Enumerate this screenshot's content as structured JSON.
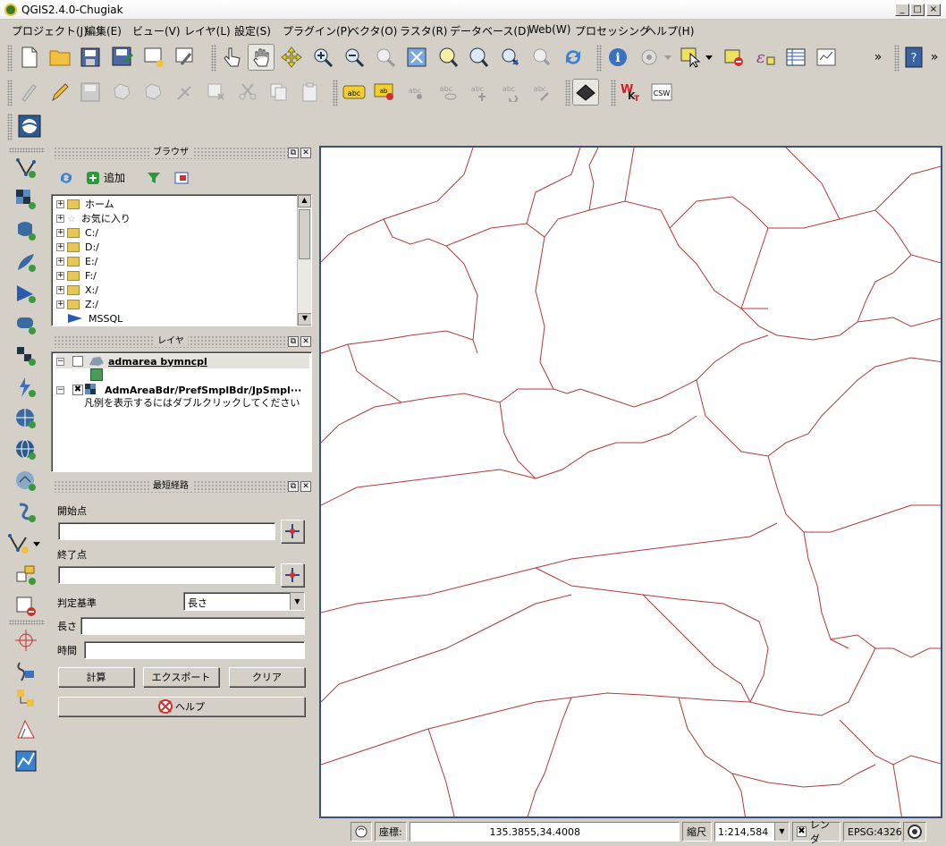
{
  "window": {
    "title": "QGIS2.4.0-Chugiak",
    "minimize": "_",
    "maximize": "□",
    "close": "×"
  },
  "menu": [
    "プロジェクト(J)",
    "編集(E)",
    "ビュー(V)",
    "レイヤ(L)",
    "設定(S)",
    "プラグイン(P)",
    "ベクタ(O)",
    "ラスタ(R)",
    "データベース(D)",
    "Web(W)",
    "プロセッシング",
    "ヘルプ(H)"
  ],
  "toolbar_overflow": "»",
  "toolbar_wkt": {
    "w": "W",
    "k": "K",
    "t": "T"
  },
  "toolbar_csw": "CSW",
  "browser": {
    "title": "ブラウザ",
    "add_label": "追加",
    "items": [
      "ホーム",
      "お気に入り",
      "C:/",
      "D:/",
      "E:/",
      "F:/",
      "X:/",
      "Z:/",
      "MSSQL"
    ]
  },
  "layers": {
    "title": "レイヤ",
    "items": [
      {
        "name": "admarea bymncpl",
        "checked": false
      },
      {
        "name": "AdmAreaBdr/PrefSmplBdr/JpSmpl···",
        "checked": true,
        "legend_hint": "凡例を表示するにはダブルクリックしてください"
      }
    ],
    "fill_color": "#4a9a5a"
  },
  "shortest_path": {
    "title": "最短経路",
    "start_label": "開始点",
    "start_value": "",
    "end_label": "終了点",
    "end_value": "",
    "criteria_label": "判定基準",
    "criteria_value": "長さ",
    "length_label": "長さ",
    "length_value": "",
    "time_label": "時間",
    "time_value": "",
    "calc_button": "計算",
    "export_button": "エクスポート",
    "clear_button": "クリア",
    "help_button": "ヘルプ"
  },
  "status": {
    "coord_label": "座標:",
    "coord_value": "135.3855,34.4008",
    "scale_label": "縮尺",
    "scale_value": "1:214,584",
    "render_label": "レンダ",
    "render_checked": true,
    "crs": "EPSG:4326"
  },
  "map": {
    "boundary_color": "#b03a3a",
    "background": "#ffffff"
  }
}
